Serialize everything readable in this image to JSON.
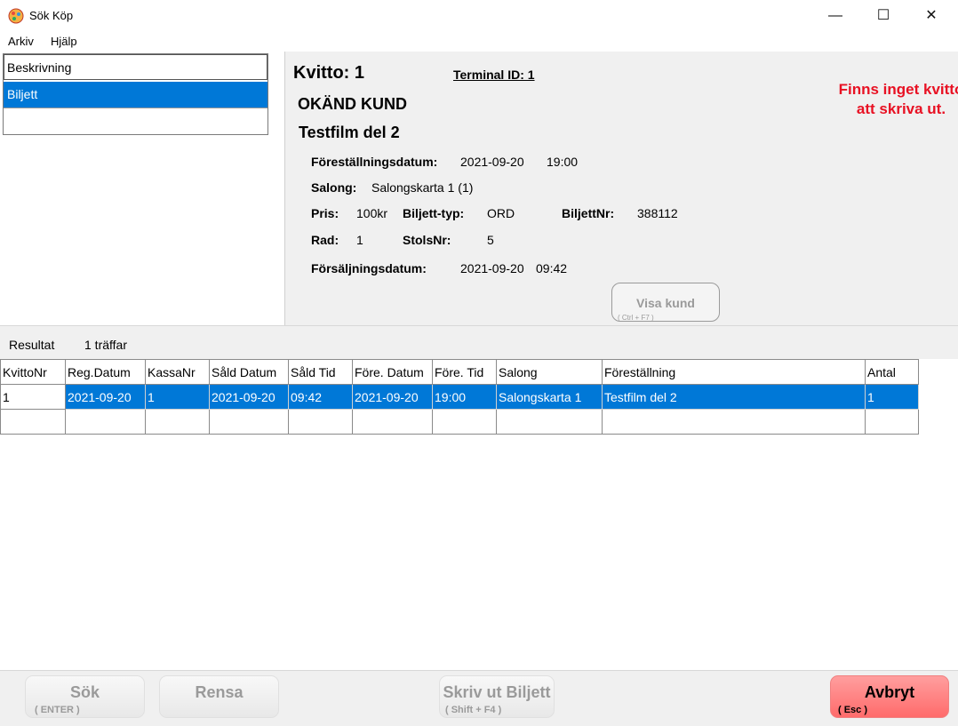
{
  "window": {
    "title": "Sök Köp",
    "minimize": "—",
    "maximize": "☐",
    "close": "✕"
  },
  "menu": [
    "Arkiv",
    "Hjälp"
  ],
  "list": {
    "header": "Beskrivning",
    "selected": "Biljett"
  },
  "receipt": {
    "kvitto_label": "Kvitto: 1",
    "terminal_label": "Terminal ID: 1",
    "customer": "OKÄND KUND",
    "film": "Testfilm del 2",
    "message_line1": "Finns inget kvitto",
    "message_line2": "att skriva ut.",
    "show_date_label": "Föreställningsdatum:",
    "show_date": "2021-09-20",
    "show_time": "19:00",
    "salong_label": "Salong:",
    "salong": "Salongskarta 1 (1)",
    "pris_label": "Pris:",
    "pris": "100kr",
    "type_label": "Biljett-typ:",
    "type": "ORD",
    "nr_label": "BiljettNr:",
    "nr": "388112",
    "rad_label": "Rad:",
    "rad": "1",
    "stol_label": "StolsNr:",
    "stol": "5",
    "sale_date_label": "Försäljningsdatum:",
    "sale_date": "2021-09-20",
    "sale_time": "09:42",
    "visa_kund": "Visa kund",
    "visa_kund_shortcut": "( Ctrl + F7 )"
  },
  "result": {
    "label": "Resultat",
    "count": "1 träffar"
  },
  "table": {
    "columns": [
      "KvittoNr",
      "Reg.Datum",
      "KassaNr",
      "Såld Datum",
      "Såld Tid",
      "Före. Datum",
      "Före. Tid",
      "Salong",
      "Föreställning",
      "Antal"
    ],
    "rows": [
      [
        "1",
        "2021-09-20",
        "1",
        "2021-09-20",
        "09:42",
        "2021-09-20",
        "19:00",
        "Salongskarta 1",
        "Testfilm del 2",
        "1"
      ]
    ]
  },
  "buttons": {
    "sok": "Sök",
    "sok_key": "( ENTER )",
    "rensa": "Rensa",
    "skriv": "Skriv ut Biljett",
    "skriv_key": "( Shift + F4 )",
    "avbryt": "Avbryt",
    "avbryt_key": "( Esc )"
  },
  "colors": {
    "selection": "#0078d7",
    "message": "#e81123",
    "cancel": "#ff7b7b"
  }
}
